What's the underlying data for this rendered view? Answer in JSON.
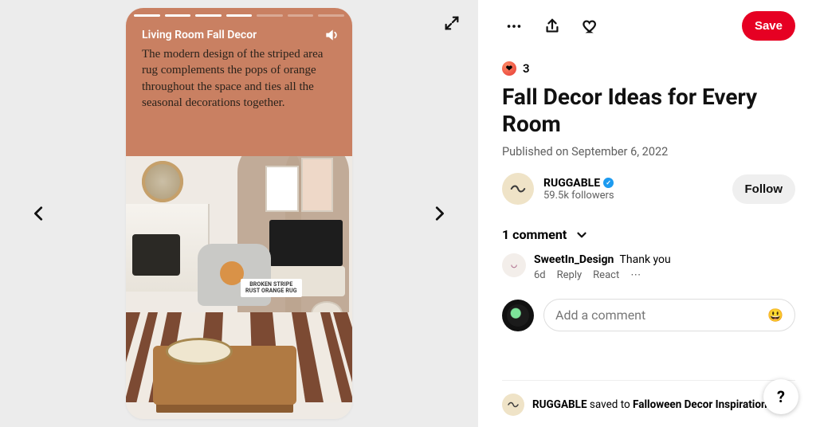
{
  "story": {
    "segments_total": 7,
    "segments_done": 4,
    "heading": "Living Room Fall Decor",
    "body": "The modern design of the striped area rug complements the pops of orange throughout the space and ties all the seasonal decorations together.",
    "product_tag_line1": "BROKEN STRIPE",
    "product_tag_line2": "RUST ORANGE RUG"
  },
  "actions": {
    "save_label": "Save"
  },
  "reactions": {
    "count": "3"
  },
  "pin": {
    "title": "Fall Decor Ideas for Every Room",
    "published": "Published on September 6, 2022"
  },
  "author": {
    "name": "RUGGABLE",
    "followers": "59.5k followers",
    "follow_label": "Follow"
  },
  "comments": {
    "header": "1 comment",
    "items": [
      {
        "name": "SweetIn_Design",
        "text": "Thank you",
        "age": "6d",
        "reply": "Reply",
        "react": "React"
      }
    ]
  },
  "compose": {
    "placeholder": "Add a comment"
  },
  "saved": {
    "actor": "RUGGABLE",
    "verb": "saved to",
    "board": "Falloween Decor Inspirations"
  },
  "help": {
    "label": "?"
  }
}
